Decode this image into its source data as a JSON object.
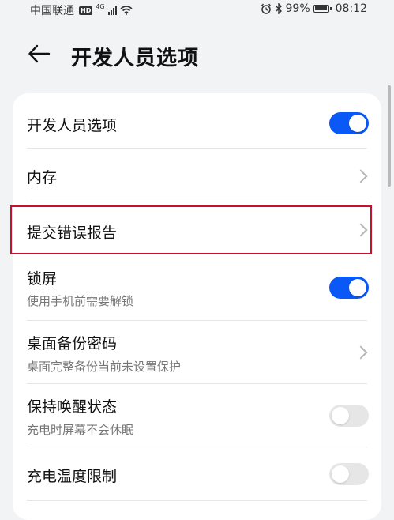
{
  "status_bar": {
    "carrier": "中国联通",
    "hd_badge": "HD",
    "network": "4G",
    "battery_percent": "99%",
    "time": "08:12",
    "icons": [
      "hd-icon",
      "signal-icon",
      "wifi-icon",
      "alarm-icon",
      "bluetooth-icon",
      "battery-icon"
    ]
  },
  "header": {
    "title": "开发人员选项",
    "back_icon": "back-arrow-icon"
  },
  "settings": [
    {
      "title": "开发人员选项",
      "subtitle": "",
      "control": "toggle",
      "on": true
    },
    {
      "title": "内存",
      "subtitle": "",
      "control": "chevron"
    },
    {
      "title": "提交错误报告",
      "subtitle": "",
      "control": "chevron",
      "highlighted": true
    },
    {
      "title": "锁屏",
      "subtitle": "使用手机前需要解锁",
      "control": "toggle",
      "on": true
    },
    {
      "title": "桌面备份密码",
      "subtitle": "桌面完整备份当前未设置保护",
      "control": "chevron"
    },
    {
      "title": "保持唤醒状态",
      "subtitle": "充电时屏幕不会休眠",
      "control": "toggle",
      "on": false
    },
    {
      "title": "充电温度限制",
      "subtitle": "",
      "control": "toggle",
      "on": false
    }
  ],
  "colors": {
    "accent": "#0a59f7",
    "highlight": "#c8102e",
    "background": "#f1f3f5"
  }
}
